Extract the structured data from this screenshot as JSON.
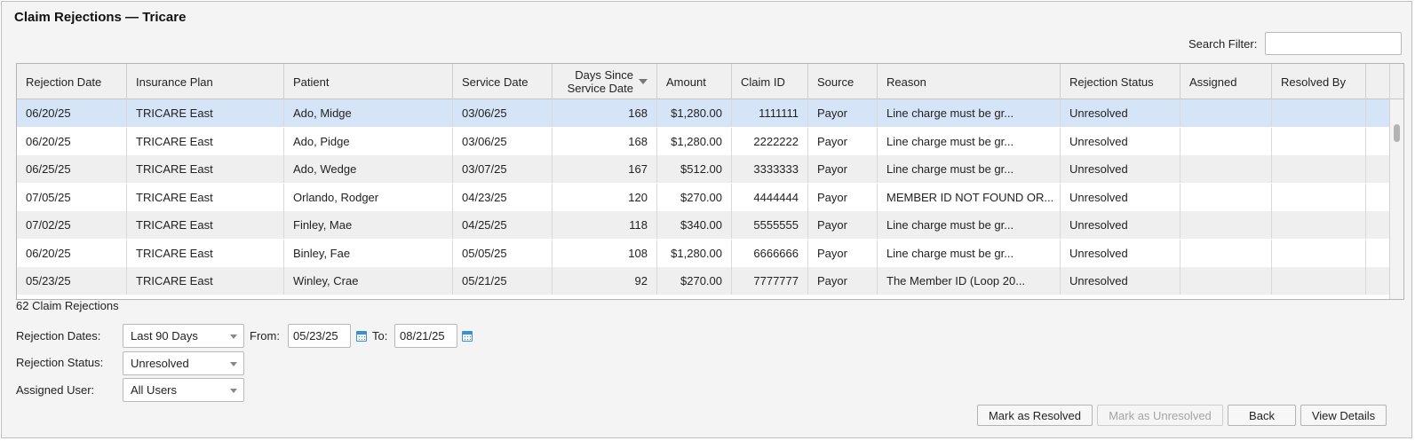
{
  "window": {
    "title": "Claim Rejections — Tricare"
  },
  "search": {
    "label": "Search Filter:",
    "value": ""
  },
  "table": {
    "columns": [
      "Rejection Date",
      "Insurance Plan",
      "Patient",
      "Service Date",
      "Days Since Service Date",
      "Amount",
      "Claim ID",
      "Source",
      "Reason",
      "Rejection Status",
      "Assigned",
      "Resolved By"
    ],
    "days_header_line1": "Days Since",
    "days_header_line2": "Service Date",
    "sorted_column": "Days Since Service Date",
    "sort_direction": "descending",
    "selected_row": 0,
    "rows": [
      [
        "06/20/25",
        "TRICARE East",
        "Ado, Midge",
        "03/06/25",
        "168",
        "$1,280.00",
        "1111111",
        "Payor",
        "Line charge must be gr...",
        "Unresolved",
        "",
        ""
      ],
      [
        "06/20/25",
        "TRICARE East",
        "Ado, Pidge",
        "03/06/25",
        "168",
        "$1,280.00",
        "2222222",
        "Payor",
        "Line charge must be gr...",
        "Unresolved",
        "",
        ""
      ],
      [
        "06/25/25",
        "TRICARE East",
        "Ado, Wedge",
        "03/07/25",
        "167",
        "$512.00",
        "3333333",
        "Payor",
        "Line charge must be gr...",
        "Unresolved",
        "",
        ""
      ],
      [
        "07/05/25",
        "TRICARE East",
        "Orlando, Rodger",
        "04/23/25",
        "120",
        "$270.00",
        "4444444",
        "Payor",
        "MEMBER ID NOT FOUND OR...",
        "Unresolved",
        "",
        ""
      ],
      [
        "07/02/25",
        "TRICARE East",
        "Finley, Mae",
        "04/25/25",
        "118",
        "$340.00",
        "5555555",
        "Payor",
        "Line charge must be gr...",
        "Unresolved",
        "",
        ""
      ],
      [
        "06/20/25",
        "TRICARE East",
        "Binley, Fae",
        "05/05/25",
        "108",
        "$1,280.00",
        "6666666",
        "Payor",
        "Line charge must be gr...",
        "Unresolved",
        "",
        ""
      ],
      [
        "05/23/25",
        "TRICARE East",
        "Winley, Crae",
        "05/21/25",
        "92",
        "$270.00",
        "7777777",
        "Payor",
        "The Member ID (Loop 20...",
        "Unresolved",
        "",
        ""
      ]
    ]
  },
  "summary": {
    "count_text": "62 Claim Rejections"
  },
  "filters": {
    "rejection_dates_label": "Rejection Dates:",
    "rejection_dates_value": "Last 90 Days",
    "from_label": "From:",
    "from_value": "05/23/25",
    "to_label": "To:",
    "to_value": "08/21/25",
    "rejection_status_label": "Rejection Status:",
    "rejection_status_value": "Unresolved",
    "assigned_user_label": "Assigned User:",
    "assigned_user_value": "All Users"
  },
  "buttons": {
    "mark_resolved": "Mark as Resolved",
    "mark_unresolved": "Mark as Unresolved",
    "back": "Back",
    "view_details": "View Details"
  },
  "colors": {
    "selected_row": "#d6e4f7",
    "alt_row": "#efefef",
    "calendar_icon": "#3a8fd9"
  },
  "icons": [
    "chevron-down-icon",
    "sort-descending-icon",
    "calendar-icon"
  ]
}
